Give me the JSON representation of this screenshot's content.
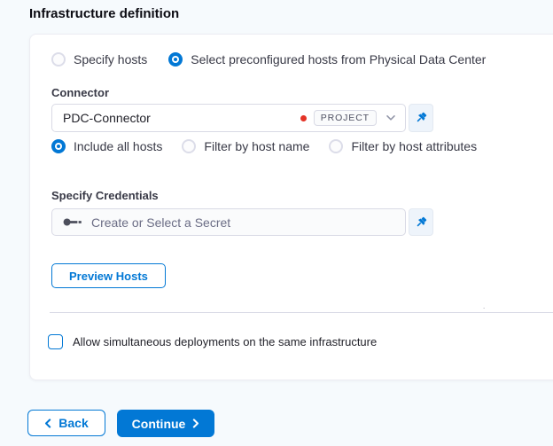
{
  "title": "Infrastructure definition",
  "host_source": {
    "options": [
      {
        "label": "Specify hosts",
        "selected": false
      },
      {
        "label": "Select preconfigured hosts from Physical Data Center",
        "selected": true
      }
    ]
  },
  "connector": {
    "label": "Connector",
    "value": "PDC-Connector",
    "scope_badge": "PROJECT"
  },
  "host_filter": {
    "options": [
      {
        "label": "Include all hosts",
        "selected": true
      },
      {
        "label": "Filter by host name",
        "selected": false
      },
      {
        "label": "Filter by host attributes",
        "selected": false
      }
    ]
  },
  "credentials": {
    "label": "Specify Credentials",
    "placeholder": "Create or Select a Secret"
  },
  "actions": {
    "preview_hosts": "Preview Hosts"
  },
  "options": {
    "simultaneous_label": "Allow simultaneous deployments on the same infrastructure",
    "checked": false
  },
  "footer": {
    "back_label": "Back",
    "continue_label": "Continue"
  },
  "misc": {
    "stray_mark": "."
  },
  "colors": {
    "primary": "#0278d5",
    "text": "#22222a",
    "muted_text": "#6b6d85",
    "border": "#d9dae5",
    "required_dot": "#e43326",
    "page_bg": "#f6fafd",
    "card_bg": "#ffffff",
    "pin_panel_bg": "#eef4fb"
  },
  "icons": {
    "pin": "pin-icon",
    "key": "key-icon",
    "chevron_down": "chevron-down-icon",
    "chevron_left": "chevron-left-icon",
    "chevron_right": "chevron-right-icon"
  }
}
